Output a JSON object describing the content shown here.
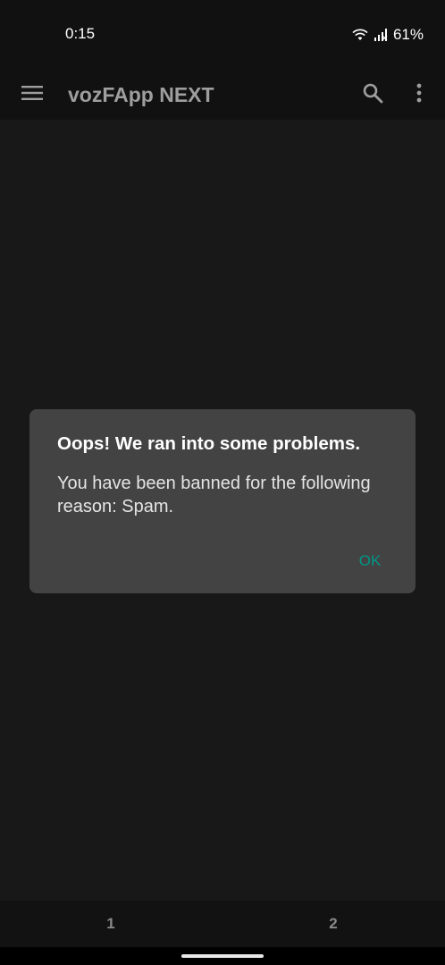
{
  "status_bar": {
    "time": "0:15",
    "battery": "61%",
    "icons": [
      "wifi-icon",
      "signal-icon"
    ]
  },
  "app_bar": {
    "title": "vozFApp NEXT",
    "icons": [
      "menu-icon",
      "search-icon",
      "more-vert-icon"
    ]
  },
  "dialog": {
    "title": "Oops! We ran into some problems.",
    "message": "You have been banned for the following reason: Spam.",
    "ok_label": "OK"
  },
  "pages": {
    "page1": "1",
    "page2": "2"
  },
  "colors": {
    "background": "#181818",
    "app_bar": "#111111",
    "dialog": "#434343",
    "accent": "#009688"
  }
}
